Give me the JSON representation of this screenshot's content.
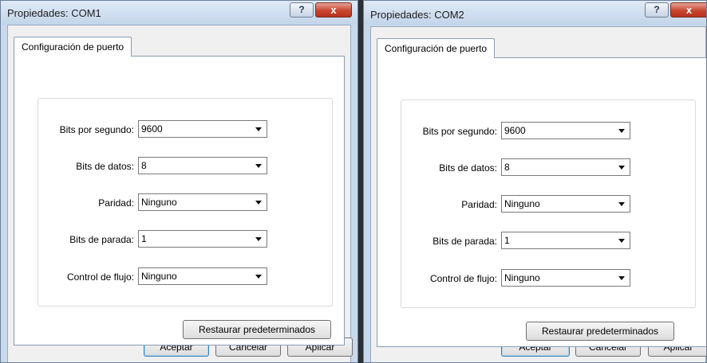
{
  "windows": [
    {
      "title": "Propiedades: COM1",
      "help_glyph": "?",
      "close_glyph": "x",
      "tab_label": "Configuración de puerto",
      "fields": [
        {
          "label": "Bits por segundo:",
          "value": "9600"
        },
        {
          "label": "Bits de datos:",
          "value": "8"
        },
        {
          "label": "Paridad:",
          "value": "Ninguno"
        },
        {
          "label": "Bits de parada:",
          "value": "1"
        },
        {
          "label": "Control de flujo:",
          "value": "Ninguno"
        }
      ],
      "restore_label": "Restaurar predeterminados",
      "accept_label": "Aceptar",
      "cancel_label": "Cancelar",
      "apply_label": "Aplicar"
    },
    {
      "title": "Propiedades: COM2",
      "help_glyph": "?",
      "close_glyph": "x",
      "tab_label": "Configuración de puerto",
      "fields": [
        {
          "label": "Bits por segundo:",
          "value": "9600"
        },
        {
          "label": "Bits de datos:",
          "value": "8"
        },
        {
          "label": "Paridad:",
          "value": "Ninguno"
        },
        {
          "label": "Bits de parada:",
          "value": "1"
        },
        {
          "label": "Control de flujo:",
          "value": "Ninguno"
        }
      ],
      "restore_label": "Restaurar predeterminados",
      "accept_label": "Aceptar",
      "cancel_label": "Cancelar",
      "apply_label": "Aplicar"
    }
  ],
  "colors": {
    "title_bar": "#c9d9ec",
    "close_button": "#c8452f",
    "panel": "#f0f0f0"
  }
}
